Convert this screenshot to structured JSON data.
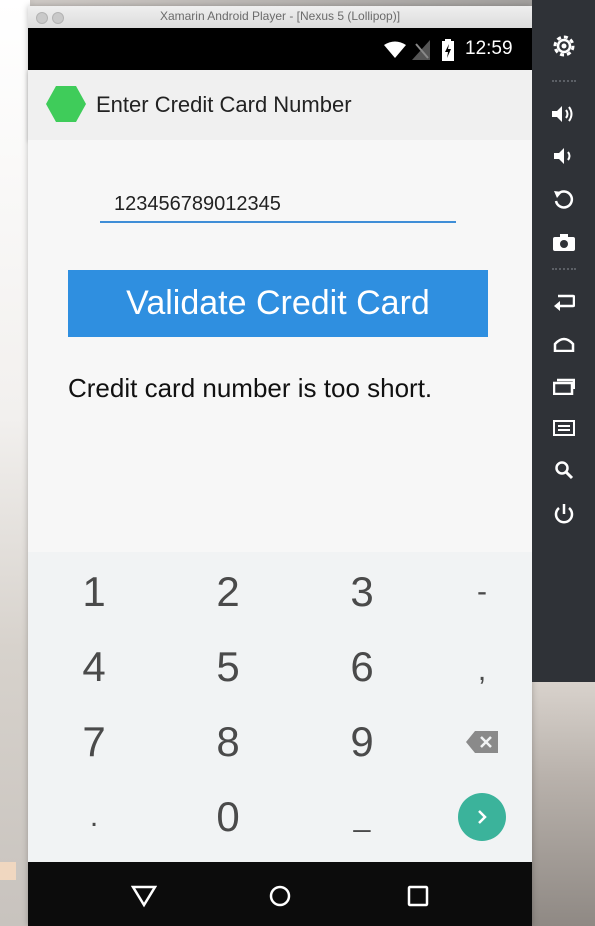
{
  "window": {
    "title": "Xamarin Android Player - [Nexus 5 (Lollipop)]"
  },
  "status_bar": {
    "time": "12:59"
  },
  "action_bar": {
    "title": "Enter Credit Card Number"
  },
  "form": {
    "card_number_value": "123456789012345",
    "validate_label": "Validate Credit Card",
    "result_message": "Credit card number is too short."
  },
  "keypad": {
    "keys": [
      "1",
      "2",
      "3",
      "-",
      "4",
      "5",
      "6",
      ",",
      "7",
      "8",
      "9",
      ".",
      "0",
      "_"
    ]
  },
  "colors": {
    "accent": "#2f8fe0",
    "enter": "#3bb39b"
  },
  "icons": {
    "app": "hexagon-icon",
    "sidebar": [
      "settings-icon",
      "volume-up-icon",
      "volume-down-icon",
      "rotate-icon",
      "camera-icon",
      "back-icon",
      "home-icon",
      "recents-icon",
      "menu-icon",
      "search-icon",
      "power-icon"
    ],
    "nav": [
      "nav-back-icon",
      "nav-home-icon",
      "nav-recents-icon"
    ]
  }
}
